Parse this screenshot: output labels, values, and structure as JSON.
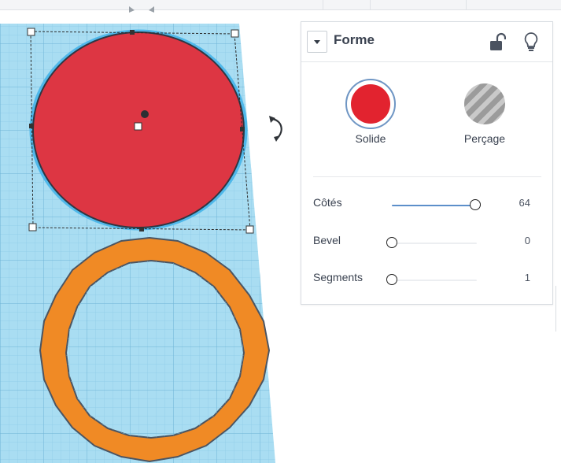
{
  "panel": {
    "title": "Forme",
    "type_options": [
      {
        "label": "Solide",
        "selected": true,
        "color": "#e2232f"
      },
      {
        "label": "Perçage",
        "selected": false,
        "color": "#a6a6a6"
      }
    ],
    "properties": [
      {
        "label": "Côtés",
        "value": "64",
        "fraction": 0.98
      },
      {
        "label": "Bevel",
        "value": "0",
        "fraction": 0.0
      },
      {
        "label": "Segments",
        "value": "1",
        "fraction": 0.0
      }
    ]
  },
  "scene": {
    "workplane_color": "#a9ddf2",
    "cylinder_color": "#dd3643",
    "tube_color": "#f08a25"
  },
  "icons": {
    "collapse": "chevron-down-icon",
    "lock": "lock-open-icon",
    "light": "lightbulb-icon",
    "rotate": "rotate-arrow-icon"
  }
}
